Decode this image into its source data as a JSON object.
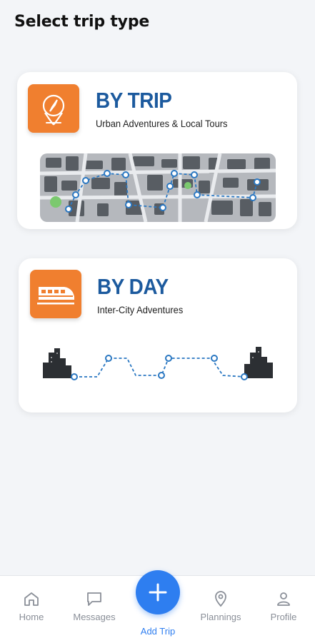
{
  "header": {
    "title": "Select trip type"
  },
  "options": [
    {
      "title": "BY TRIP",
      "subtitle": "Urban Adventures & Local Tours",
      "icon": "compass-pin-icon"
    },
    {
      "title": "BY DAY",
      "subtitle": "Inter-City Adventures",
      "icon": "train-icon"
    }
  ],
  "colors": {
    "accent": "#f07f2f",
    "title": "#1c5a9e",
    "route": "#2b78c2",
    "primary": "#2e7ef0"
  },
  "nav": {
    "items": [
      {
        "label": "Home",
        "icon": "home-icon"
      },
      {
        "label": "Messages",
        "icon": "message-icon"
      },
      {
        "label": "Add Trip",
        "icon": "plus-icon"
      },
      {
        "label": "Plannings",
        "icon": "location-pin-icon"
      },
      {
        "label": "Profile",
        "icon": "user-icon"
      }
    ]
  }
}
